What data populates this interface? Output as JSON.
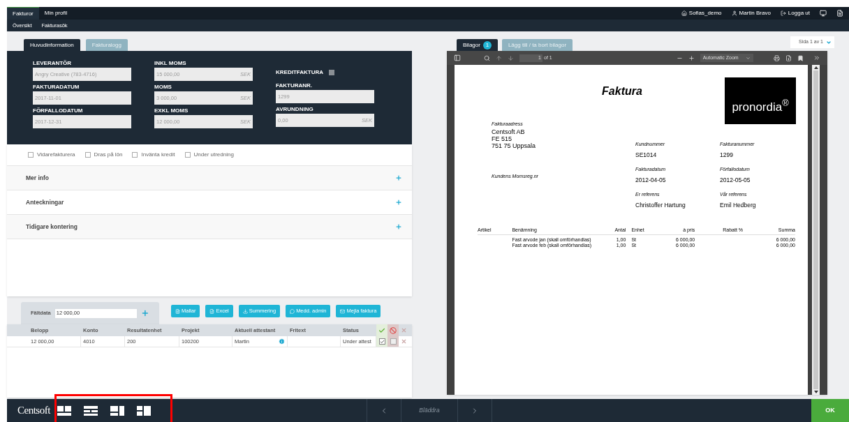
{
  "top_nav": {
    "menu": [
      {
        "label": "Fakturor",
        "selected": true
      },
      {
        "label": "Min profil",
        "selected": false
      }
    ],
    "submenu": [
      {
        "label": "Översikt"
      },
      {
        "label": "Fakturasök"
      }
    ],
    "user_links": [
      {
        "kind": "home",
        "label": "Sofias_demo"
      },
      {
        "kind": "user",
        "label": "Martin Bravo"
      },
      {
        "kind": "logout",
        "label": "Logga ut"
      }
    ]
  },
  "left_tabs": [
    {
      "label": "Huvudinformation",
      "selected": true
    },
    {
      "label": "Fakturalogg",
      "selected": false
    }
  ],
  "form_columns": [
    [
      {
        "kind": "field",
        "label": "LEVERANTÖR",
        "value": "Angry Creative (783-4716)"
      },
      {
        "kind": "field",
        "label": "FAKTURADATUM",
        "value": "2017-11-01"
      },
      {
        "kind": "field",
        "label": "FÖRFALLODATUM",
        "value": "2017-12-31"
      }
    ],
    [
      {
        "kind": "field",
        "label": "INKL MOMS",
        "value": "15 000,00",
        "unit": "SEK"
      },
      {
        "kind": "field",
        "label": "MOMS",
        "value": "3 000,00",
        "unit": "SEK"
      },
      {
        "kind": "field",
        "label": "EXKL MOMS",
        "value": "12 000,00",
        "unit": "SEK"
      }
    ],
    [
      {
        "kind": "checkbox",
        "label": "KREDITFAKTURA",
        "checked": false
      },
      {
        "kind": "field",
        "label": "FAKTURANR.",
        "value": "1299"
      },
      {
        "kind": "field",
        "label": "AVRUNDNING",
        "value": "0,00",
        "unit": "SEK"
      }
    ]
  ],
  "options": [
    {
      "label": "Vidarefakturera",
      "checked": false
    },
    {
      "label": "Dras på lön",
      "checked": false
    },
    {
      "label": "Invänta kredit",
      "checked": false
    },
    {
      "label": "Under utredning",
      "checked": false
    }
  ],
  "sections": [
    {
      "title": "Mer info",
      "expanded": false
    },
    {
      "title": "Anteckningar",
      "expanded": false
    },
    {
      "title": "Tidigare kontering",
      "expanded": false
    }
  ],
  "faltdata": {
    "label": "Fältdata",
    "value": "12 000,00"
  },
  "actions": [
    {
      "kind": "file",
      "label": "Mallar"
    },
    {
      "kind": "sheet",
      "label": "Excel"
    },
    {
      "kind": "download",
      "label": "Summering"
    },
    {
      "kind": "comment",
      "label": "Medd. admin"
    },
    {
      "kind": "mail",
      "label": "Mejla faktura"
    }
  ],
  "table": {
    "columns": [
      "Belopp",
      "Konto",
      "Resultatenhet",
      "Projekt",
      "Aktuell attestant",
      "Fritext",
      "Status"
    ],
    "rows": [
      {
        "cells": [
          "12 000,00",
          "4010",
          "200",
          "100200",
          "Martin",
          "",
          "Under attest"
        ],
        "approved": true,
        "rejected": false
      }
    ]
  },
  "attachments": {
    "tabs": [
      {
        "label": "Bilagor",
        "badge": "1",
        "selected": true
      },
      {
        "label": "Lägg till / ta bort bilagor",
        "selected": false
      }
    ],
    "page_select": "Sida 1 av 1"
  },
  "viewer": {
    "page": "1",
    "page_count": "of 1",
    "zoom": "Automatic Zoom"
  },
  "document": {
    "title": "Faktura",
    "logo": "pronordia$^{®}$",
    "address_label": "Fakturaadress",
    "address": [
      "Centsoft AB",
      "FE 515",
      "751 75 Uppsala"
    ],
    "vat_label": "Kundens Momsreg.nr",
    "info": [
      [
        {
          "label": "Kundnummer",
          "value": "SE1014"
        },
        {
          "label": "Fakturanummer",
          "value": "1299"
        }
      ],
      [
        {
          "label": "Fakturadatum",
          "value": "2012-04-05"
        },
        {
          "label": "Förfallodatum",
          "value": "2012-05-05"
        }
      ],
      [
        {
          "label": "Er referens",
          "value": "Christoffer Hartung"
        },
        {
          "label": "Vår referens",
          "value": "Emil Hedberg"
        }
      ]
    ],
    "columns": [
      "Artikel",
      "Benämning",
      "Antal",
      "Enhet",
      "à pris",
      "Rabatt %",
      "Summa"
    ],
    "rows": [
      [
        "",
        "Fast arvode jan (skall omförhandlas)",
        "1,00",
        "St",
        "6 000,00",
        "",
        "6 000,00"
      ],
      [
        "",
        "Fast arvode feb (skall omförhandlas)",
        "1,00",
        "St",
        "6 000,00",
        "",
        "6 000,00"
      ]
    ]
  },
  "footer": {
    "logo": "Centsoft",
    "browse": "Bläddra",
    "ok": "OK"
  }
}
